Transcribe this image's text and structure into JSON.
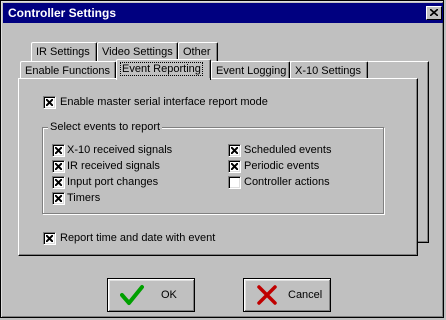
{
  "window": {
    "title": "Controller Settings",
    "close_icon": "close-icon"
  },
  "tabs_back": [
    {
      "label": "IR Settings"
    },
    {
      "label": "Video Settings"
    },
    {
      "label": "Other"
    }
  ],
  "tabs_front": [
    {
      "label": "Enable Functions",
      "active": false
    },
    {
      "label": "Event Reporting",
      "active": true
    },
    {
      "label": "Event Logging",
      "active": false
    },
    {
      "label": "X-10 Settings",
      "active": false
    }
  ],
  "event_reporting": {
    "enable_master": {
      "label": "Enable master serial interface report mode",
      "checked": true
    },
    "group_label": "Select events to report",
    "events_left": [
      {
        "label": "X-10 received signals",
        "checked": true
      },
      {
        "label": "IR received signals",
        "checked": true
      },
      {
        "label": "Input port changes",
        "checked": true
      },
      {
        "label": "Timers",
        "checked": true
      }
    ],
    "events_right": [
      {
        "label": "Scheduled events",
        "checked": true
      },
      {
        "label": "Periodic events",
        "checked": true
      },
      {
        "label": "Controller actions",
        "checked": false
      }
    ],
    "report_time": {
      "label": "Report time and date with event",
      "checked": true
    }
  },
  "buttons": {
    "ok": {
      "label": "OK",
      "icon": "checkmark-icon",
      "color": "#00a000"
    },
    "cancel": {
      "label": "Cancel",
      "icon": "x-mark-icon",
      "color": "#c00000"
    }
  }
}
